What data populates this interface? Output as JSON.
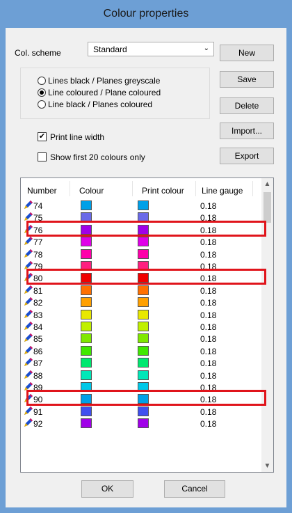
{
  "window": {
    "title": "Colour properties"
  },
  "scheme": {
    "label": "Col. scheme",
    "value": "Standard"
  },
  "buttons": {
    "new": "New",
    "save": "Save",
    "delete": "Delete",
    "import": "Import...",
    "export": "Export",
    "ok": "OK",
    "cancel": "Cancel"
  },
  "radios": [
    {
      "label": "Lines black / Planes greyscale",
      "selected": false
    },
    {
      "label": "Line coloured / Plane coloured",
      "selected": true
    },
    {
      "label": "Line black / Planes coloured",
      "selected": false
    }
  ],
  "checks": [
    {
      "label": "Print line width",
      "checked": true
    },
    {
      "label": "Show first 20 colours only",
      "checked": false
    }
  ],
  "table": {
    "headers": [
      "Number",
      "Colour",
      "Print colour",
      "Line gauge"
    ],
    "rows": [
      {
        "num": "74",
        "colour": "#00a0e8",
        "print": "#00a0e8",
        "gauge": "0.18"
      },
      {
        "num": "75",
        "colour": "#6a6ae8",
        "print": "#6a6ae8",
        "gauge": "0.18"
      },
      {
        "num": "76",
        "colour": "#a000e8",
        "print": "#a000e8",
        "gauge": "0.18"
      },
      {
        "num": "77",
        "colour": "#e000e8",
        "print": "#e000e8",
        "gauge": "0.18"
      },
      {
        "num": "78",
        "colour": "#ff00aa",
        "print": "#ff00aa",
        "gauge": "0.18"
      },
      {
        "num": "79",
        "colour": "#ff2080",
        "print": "#ff2080",
        "gauge": "0.18"
      },
      {
        "num": "80",
        "colour": "#f00000",
        "print": "#f00000",
        "gauge": "0.18"
      },
      {
        "num": "81",
        "colour": "#ff7000",
        "print": "#ff7000",
        "gauge": "0.18"
      },
      {
        "num": "82",
        "colour": "#ffa000",
        "print": "#ffa000",
        "gauge": "0.18"
      },
      {
        "num": "83",
        "colour": "#e8e800",
        "print": "#e8e800",
        "gauge": "0.18"
      },
      {
        "num": "84",
        "colour": "#c0f000",
        "print": "#c0f000",
        "gauge": "0.18"
      },
      {
        "num": "85",
        "colour": "#80e800",
        "print": "#80e800",
        "gauge": "0.18"
      },
      {
        "num": "86",
        "colour": "#40e800",
        "print": "#40e800",
        "gauge": "0.18"
      },
      {
        "num": "87",
        "colour": "#00e870",
        "print": "#00e870",
        "gauge": "0.18"
      },
      {
        "num": "88",
        "colour": "#00e8b8",
        "print": "#00e8b8",
        "gauge": "0.18"
      },
      {
        "num": "89",
        "colour": "#00c8e8",
        "print": "#00c8e8",
        "gauge": "0.18"
      },
      {
        "num": "90",
        "colour": "#00a0e8",
        "print": "#00a0e8",
        "gauge": "0.18"
      },
      {
        "num": "91",
        "colour": "#4050f0",
        "print": "#4050f0",
        "gauge": "0.18"
      },
      {
        "num": "92",
        "colour": "#a000e8",
        "print": "#a000e8",
        "gauge": "0.18"
      }
    ],
    "highlighted": [
      "76",
      "80",
      "90"
    ]
  },
  "colors": {
    "titlebar": "#6d9fd5",
    "highlight": "#e0141b"
  }
}
